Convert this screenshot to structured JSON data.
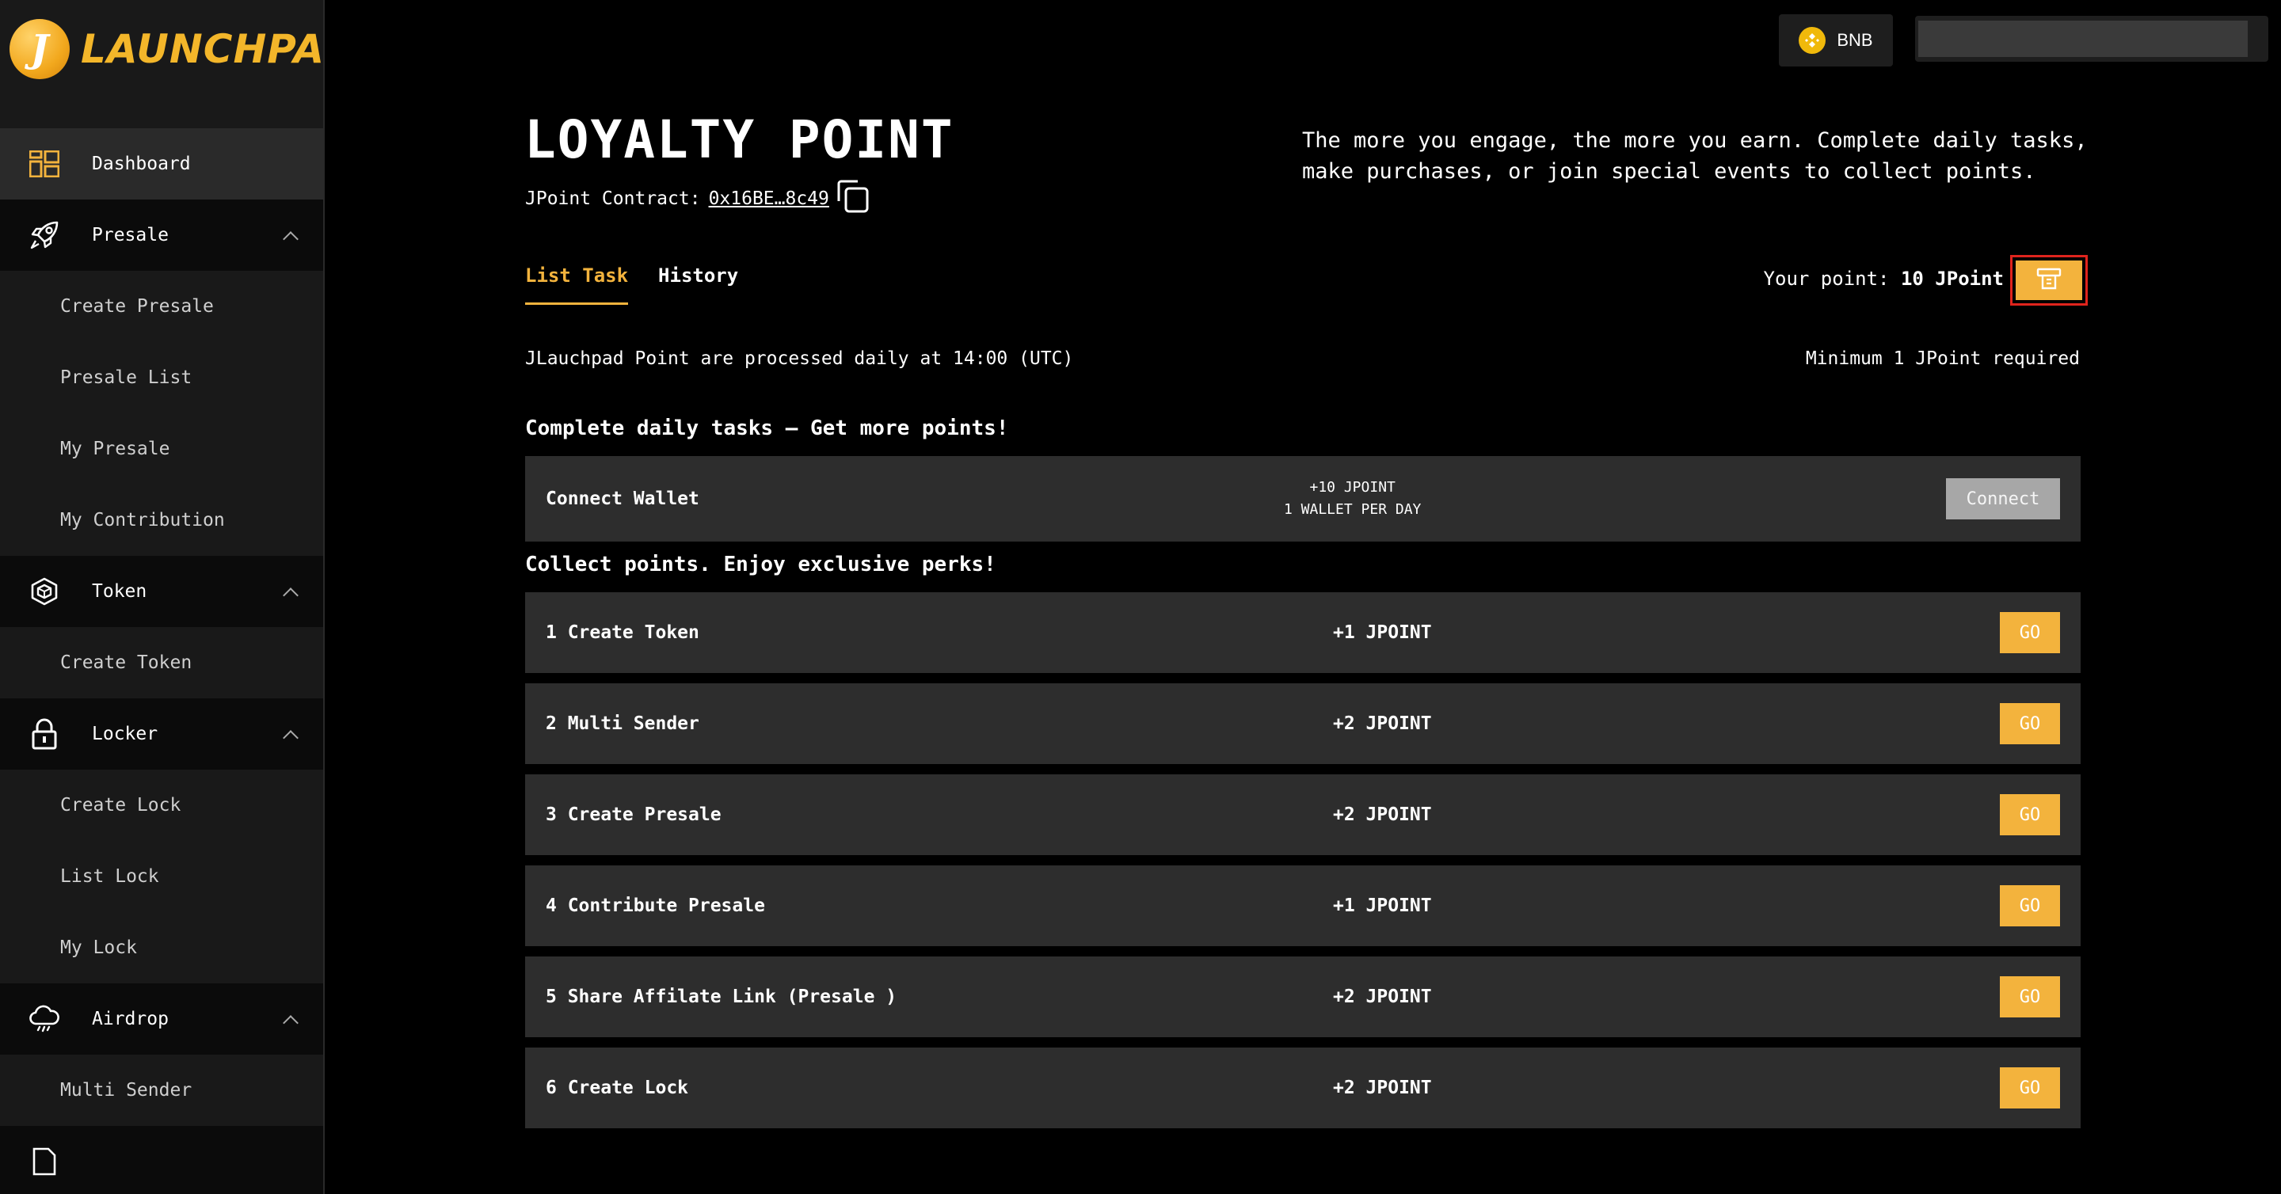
{
  "brand": {
    "logo_letter": "J",
    "name": "LAUNCHPAD"
  },
  "sidebar": {
    "items": [
      {
        "label": "Dashboard",
        "icon": "dashboard-icon",
        "active": true,
        "children": []
      },
      {
        "label": "Presale",
        "icon": "rocket-icon",
        "children": [
          "Create Presale",
          "Presale List",
          "My Presale",
          "My Contribution"
        ]
      },
      {
        "label": "Token",
        "icon": "cube-icon",
        "children": [
          "Create Token"
        ]
      },
      {
        "label": "Locker",
        "icon": "lock-icon",
        "children": [
          "Create Lock",
          "List Lock",
          "My Lock"
        ]
      },
      {
        "label": "Airdrop",
        "icon": "cloud-icon",
        "children": [
          "Multi Sender"
        ]
      }
    ]
  },
  "header": {
    "network_label": "BNB",
    "network_icon": "bnb-icon"
  },
  "page": {
    "title": "LOYALTY POINT",
    "contract_label": "JPoint Contract:",
    "contract_address": "0x16BE…8c49",
    "intro": "The more you engage, the more you earn. Complete daily tasks, make purchases, or join special events to collect points.",
    "tabs": [
      "List Task",
      "History"
    ],
    "your_point_label": "Your point:",
    "your_point_value": "10 JPoint",
    "processed_note": "JLauchpad Point are processed daily at 14:00 (UTC)",
    "minimum_note": "Minimum 1 JPoint required",
    "daily_title": "Complete daily tasks – Get more points!",
    "daily_task": {
      "name": "Connect Wallet",
      "reward_line1": "+10 JPOINT",
      "reward_line2": "1 WALLET PER DAY",
      "button": "Connect"
    },
    "perks_title": "Collect points. Enjoy exclusive perks!",
    "go_label": "GO",
    "tasks": [
      {
        "name": "1 Create Token",
        "reward": "+1 JPOINT"
      },
      {
        "name": "2 Multi Sender",
        "reward": "+2 JPOINT"
      },
      {
        "name": "3 Create Presale",
        "reward": "+2 JPOINT"
      },
      {
        "name": "4 Contribute Presale",
        "reward": "+1 JPOINT"
      },
      {
        "name": "5 Share Affilate Link (Presale )",
        "reward": "+2 JPOINT"
      },
      {
        "name": "6 Create Lock",
        "reward": "+2 JPOINT"
      }
    ]
  },
  "colors": {
    "accent": "#f3b33d",
    "highlight": "#e0241d",
    "panel": "#2d2d2d",
    "sidebar": "#191919"
  }
}
